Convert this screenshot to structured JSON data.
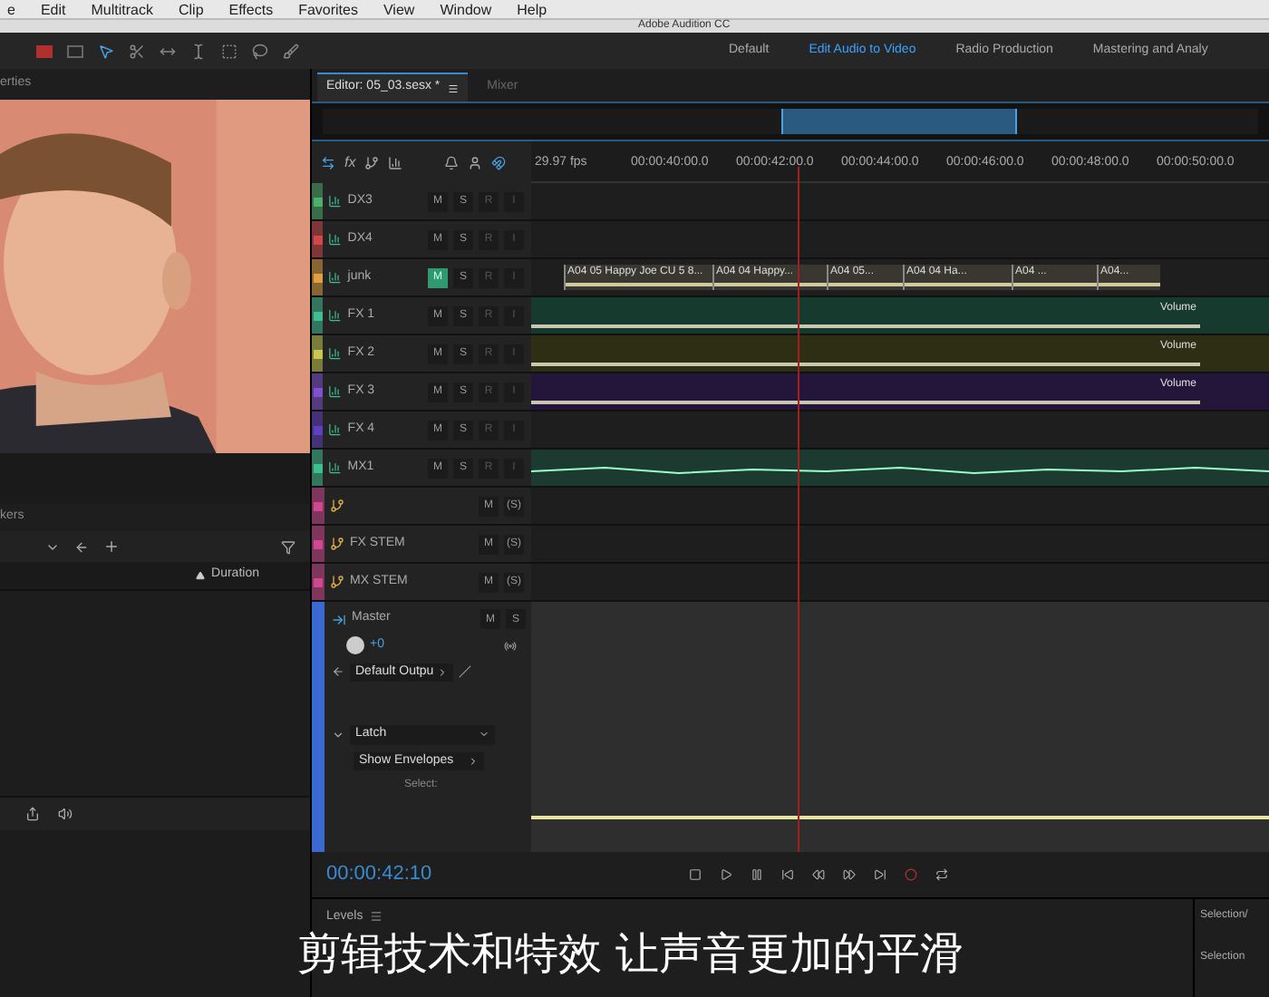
{
  "menu_bar": [
    "e",
    "Edit",
    "Multitrack",
    "Clip",
    "Effects",
    "Favorites",
    "View",
    "Window",
    "Help"
  ],
  "window": {
    "title": "Adobe Audition CC"
  },
  "workspaces": [
    {
      "label": "Default",
      "selected": false
    },
    {
      "label": "Edit Audio to Video",
      "selected": true
    },
    {
      "label": "Radio Production",
      "selected": false
    },
    {
      "label": "Mastering and Analy",
      "selected": false
    }
  ],
  "left_panel": {
    "tab": "erties",
    "markers_tab": "kers",
    "column": "Duration"
  },
  "editor": {
    "tabs": [
      {
        "label": "Editor: 05_03.sesx *",
        "selected": true
      },
      {
        "label": "Mixer",
        "selected": false
      }
    ],
    "effects_label": "fx",
    "ruler": [
      "29.97 fps",
      "00:00:40:00.0",
      "00:00:42:00.0",
      "00:00:44:00.0",
      "00:00:46:00.0",
      "00:00:48:00.0",
      "00:00:50:00.0"
    ],
    "tracks": [
      {
        "name": "DX3",
        "kind": "audio",
        "color": "#4caf6a",
        "mute": false,
        "buttons": [
          "M",
          "S",
          "R",
          "I"
        ],
        "lane": {
          "kind": "empty"
        }
      },
      {
        "name": "DX4",
        "kind": "audio",
        "color": "#d04848",
        "mute": false,
        "buttons": [
          "M",
          "S",
          "R",
          "I"
        ],
        "lane": {
          "kind": "empty"
        }
      },
      {
        "name": "junk",
        "kind": "audio",
        "color": "#e0a040",
        "mute": true,
        "buttons": [
          "M",
          "S",
          "R",
          "I"
        ],
        "lane": {
          "kind": "clips",
          "clips": [
            "A04 05 Happy Joe CU 5 8...",
            "A04 04 Happy...",
            "A04 05...",
            "A04 04 Ha...",
            "A04 ...",
            "A04..."
          ]
        }
      },
      {
        "name": "FX 1",
        "kind": "audio",
        "color": "#3fbf90",
        "mute": false,
        "buttons": [
          "M",
          "S",
          "R",
          "I"
        ],
        "lane": {
          "kind": "volume",
          "color": "#173a2e",
          "envelope": "Volume"
        }
      },
      {
        "name": "FX 2",
        "kind": "audio",
        "color": "#c8c850",
        "mute": false,
        "buttons": [
          "M",
          "S",
          "R",
          "I"
        ],
        "lane": {
          "kind": "volume",
          "color": "#2e2e14",
          "envelope": "Volume"
        }
      },
      {
        "name": "FX 3",
        "kind": "audio",
        "color": "#8050d0",
        "mute": false,
        "buttons": [
          "M",
          "S",
          "R",
          "I"
        ],
        "lane": {
          "kind": "volume",
          "color": "#24163a",
          "envelope": "Volume"
        }
      },
      {
        "name": "FX 4",
        "kind": "audio",
        "color": "#6040c0",
        "mute": false,
        "buttons": [
          "M",
          "S",
          "R",
          "I"
        ],
        "lane": {
          "kind": "empty"
        }
      },
      {
        "name": "MX1",
        "kind": "audio",
        "color": "#3fbf90",
        "mute": false,
        "buttons": [
          "M",
          "S",
          "R",
          "I"
        ],
        "lane": {
          "kind": "wave"
        }
      },
      {
        "kind": "bus",
        "color": "#d04890",
        "mute": false,
        "buttons": [
          "M",
          "(S)"
        ],
        "lane": {
          "kind": "empty"
        }
      },
      {
        "name": "FX STEM",
        "kind": "bus",
        "color": "#d04890",
        "mute": false,
        "buttons": [
          "M",
          "(S)"
        ],
        "lane": {
          "kind": "empty"
        }
      },
      {
        "name": "MX STEM",
        "kind": "bus",
        "color": "#d04890",
        "mute": false,
        "buttons": [
          "M",
          "(S)"
        ],
        "lane": {
          "kind": "empty"
        }
      }
    ],
    "master": {
      "name": "Master",
      "buttons": [
        "M",
        "S"
      ],
      "volume": "+0",
      "output": "Default Outpu",
      "automation": "Latch",
      "envelopes": "Show Envelopes",
      "select": "Select:"
    },
    "time": "00:00:42:10"
  },
  "levels_tab": "Levels",
  "selection_panel": [
    "Selection/",
    "Selection"
  ],
  "subtitle": "剪辑技术和特效 让声音更加的平滑"
}
